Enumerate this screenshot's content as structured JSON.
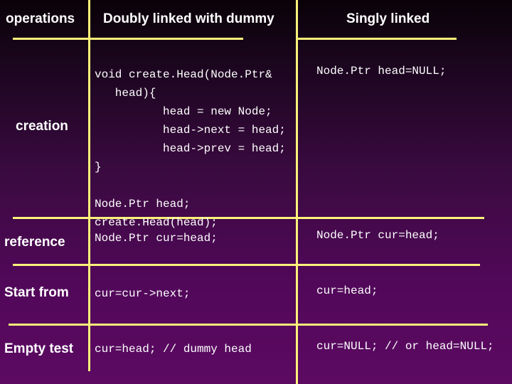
{
  "headers": {
    "operations": "operations",
    "doubly": "Doubly linked with dummy",
    "singly": "Singly linked"
  },
  "rows": {
    "creation": {
      "label": "creation",
      "doubly_lines": [
        "void create.Head(Node.Ptr&",
        "   head){",
        "          head = new Node;",
        "          head->next = head;",
        "          head->prev = head;",
        "}",
        "",
        "Node.Ptr head;",
        "create.Head(head);"
      ],
      "singly": "Node.Ptr head=NULL;"
    },
    "reference": {
      "label": "reference",
      "doubly": "Node.Ptr cur=head;",
      "singly": "Node.Ptr cur=head;"
    },
    "start_from": {
      "label": "Start from",
      "doubly": "cur=cur->next;",
      "singly": "cur=head;"
    },
    "empty_test": {
      "label": "Empty test",
      "doubly": "cur=head; // dummy head",
      "singly": "cur=NULL; // or head=NULL;"
    }
  },
  "colors": {
    "grid_line": "#fff27a",
    "text": "#ffffff",
    "background_top": "#0a0208",
    "background_bottom": "#5c0a62"
  }
}
